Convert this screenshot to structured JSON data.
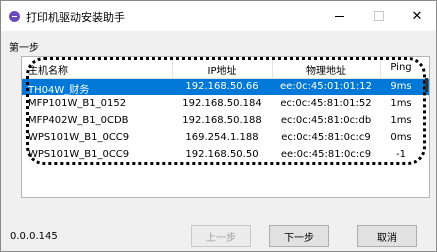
{
  "window": {
    "title": "打印机驱动安装助手",
    "minimize_label": "—",
    "close_label": "✕"
  },
  "step_label": "第一步",
  "table": {
    "headers": [
      "主机名称",
      "IP地址",
      "物理地址",
      "Ping"
    ],
    "rows": [
      {
        "host": "TH04W_财务",
        "ip": "192.168.50.66",
        "mac": "ee:0c:45:01:01:12",
        "ping": "9ms",
        "selected": true
      },
      {
        "host": "MFP101W_B1_0152",
        "ip": "192.168.50.184",
        "mac": "ec:0c:45:81:01:52",
        "ping": "1ms",
        "selected": false
      },
      {
        "host": "MFP402W_B1_0CDB",
        "ip": "192.168.50.188",
        "mac": "ec:0c:45:81:0c:db",
        "ping": "1ms",
        "selected": false
      },
      {
        "host": "WPS101W_B1_0CC9",
        "ip": "169.254.1.188",
        "mac": "ec:0c:45:81:0c:c9",
        "ping": "0ms",
        "selected": false
      },
      {
        "host": "WPS101W_B1_0CC9",
        "ip": "192.168.50.50",
        "mac": "ee:0c:45:81:0c:c9",
        "ping": "-1",
        "selected": false
      }
    ]
  },
  "version": "0.0.0.145",
  "buttons": {
    "prev": "上一步",
    "next": "下一步",
    "cancel": "取消"
  },
  "colors": {
    "selection": "#0078d7",
    "app_icon": "#6a4dbd"
  }
}
